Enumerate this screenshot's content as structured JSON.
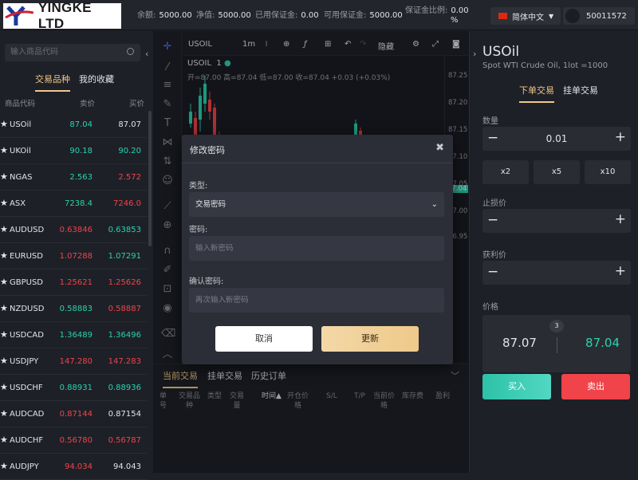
{
  "header": {
    "logo_text": "YINGKE LTD",
    "balance_label": "余额:",
    "balance": "5000.00",
    "equity_label": "净值:",
    "equity": "5000.00",
    "used_margin_label": "已用保证金:",
    "used_margin": "0.00",
    "free_margin_label": "可用保证金:",
    "free_margin": "5000.00",
    "margin_ratio_label": "保证金比例:",
    "margin_ratio": "0.00",
    "margin_ratio_unit": "%",
    "language": "简体中文",
    "account": "50011572"
  },
  "sidebar": {
    "search_placeholder": "输入商品代码",
    "tabs": [
      "交易品种",
      "我的收藏"
    ],
    "columns": [
      "商品代码",
      "卖价",
      "买价"
    ],
    "rows": [
      {
        "symbol": "USOil",
        "bid": "87.04",
        "ask": "87.07",
        "bid_dir": "up",
        "ask_dir": "white"
      },
      {
        "symbol": "UKOil",
        "bid": "90.18",
        "ask": "90.20",
        "bid_dir": "up",
        "ask_dir": "up"
      },
      {
        "symbol": "NGAS",
        "bid": "2.563",
        "ask": "2.572",
        "bid_dir": "up",
        "ask_dir": "down"
      },
      {
        "symbol": "ASX",
        "bid": "7238.4",
        "ask": "7246.0",
        "bid_dir": "up",
        "ask_dir": "down"
      },
      {
        "symbol": "AUDUSD",
        "bid": "0.63846",
        "ask": "0.63853",
        "bid_dir": "down",
        "ask_dir": "up"
      },
      {
        "symbol": "EURUSD",
        "bid": "1.07288",
        "ask": "1.07291",
        "bid_dir": "down",
        "ask_dir": "up"
      },
      {
        "symbol": "GBPUSD",
        "bid": "1.25621",
        "ask": "1.25626",
        "bid_dir": "down",
        "ask_dir": "down"
      },
      {
        "symbol": "NZDUSD",
        "bid": "0.58883",
        "ask": "0.58887",
        "bid_dir": "up",
        "ask_dir": "down"
      },
      {
        "symbol": "USDCAD",
        "bid": "1.36489",
        "ask": "1.36496",
        "bid_dir": "up",
        "ask_dir": "up"
      },
      {
        "symbol": "USDJPY",
        "bid": "147.280",
        "ask": "147.283",
        "bid_dir": "down",
        "ask_dir": "down"
      },
      {
        "symbol": "USDCHF",
        "bid": "0.88931",
        "ask": "0.88936",
        "bid_dir": "up",
        "ask_dir": "up"
      },
      {
        "symbol": "AUDCAD",
        "bid": "0.87144",
        "ask": "0.87154",
        "bid_dir": "down",
        "ask_dir": "white"
      },
      {
        "symbol": "AUDCHF",
        "bid": "0.56780",
        "ask": "0.56787",
        "bid_dir": "down",
        "ask_dir": "down"
      },
      {
        "symbol": "AUDJPY",
        "bid": "94.034",
        "ask": "94.043",
        "bid_dir": "down",
        "ask_dir": "white"
      }
    ]
  },
  "chart": {
    "symbol": "USOIL",
    "timeframe": "1m",
    "hide_label": "隐藏",
    "legend_symbol": "USOIL",
    "legend_interval": "1",
    "ohlc": "开=87.00  高=87.04  低=87.00  收=87.04  +0.03 (+0.03%)",
    "price_ticks": [
      "87.25",
      "87.20",
      "87.15",
      "87.10",
      "87.05",
      "87.04",
      "87.00",
      "86.95"
    ],
    "current_price": "87.04"
  },
  "orders": {
    "tabs": [
      "当前交易",
      "挂单交易",
      "历史订单"
    ],
    "columns": [
      "单\n号",
      "交易品\n种",
      "类型",
      "交易\n量",
      "时间▲",
      "开仓价\n格",
      "S/L",
      "T/P",
      "当前价\n格",
      "库存费",
      "盈利"
    ]
  },
  "trade_panel": {
    "symbol": "USOil",
    "description": "Spot WTI Crude Oil, 1lot =1000",
    "tabs": [
      "下单交易",
      "挂单交易"
    ],
    "quantity_label": "数量",
    "quantity": "0.01",
    "multipliers": [
      "x2",
      "x5",
      "x10"
    ],
    "stop_loss_label": "止损价",
    "take_profit_label": "获利价",
    "price_label": "价格",
    "spread": "3",
    "bid_price": "87.07",
    "ask_price": "87.04",
    "buy_label": "买入",
    "sell_label": "卖出"
  },
  "modal": {
    "title": "修改密码",
    "type_label": "类型:",
    "type_value": "交易密码",
    "password_label": "密码:",
    "password_placeholder": "输入新密码",
    "confirm_label": "确认密码:",
    "confirm_placeholder": "再次输入新密码",
    "cancel_label": "取消",
    "update_label": "更新"
  },
  "colors": {
    "accent": "#f0c88a",
    "up": "#29d3b0",
    "down": "#f0434a",
    "background": "#1e2027"
  }
}
